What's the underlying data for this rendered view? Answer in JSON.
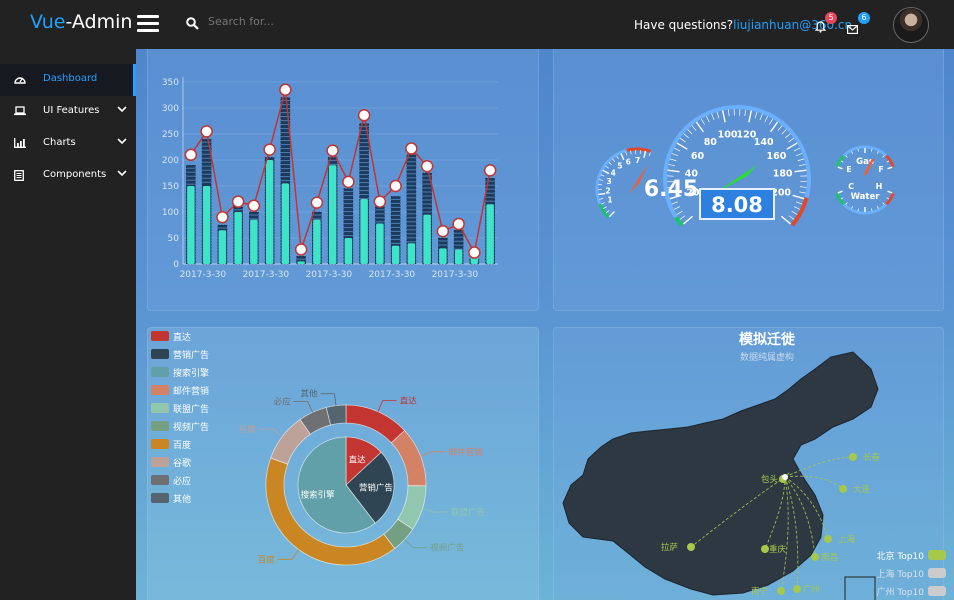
{
  "header": {
    "brand_part1": "Vue",
    "brand_part2": "-Admin",
    "search_placeholder": "Search for...",
    "question_text": "Have questions?",
    "question_email": "liujianhuan@360.cn",
    "notifications_count": "5",
    "messages_count": "6"
  },
  "sidebar": {
    "items": [
      {
        "label": "Dashboard",
        "icon": "dashboard-icon",
        "active": true
      },
      {
        "label": "UI Features",
        "icon": "laptop-icon",
        "expandable": true
      },
      {
        "label": "Charts",
        "icon": "bar-chart-icon",
        "expandable": true
      },
      {
        "label": "Components",
        "icon": "document-icon",
        "expandable": true
      }
    ]
  },
  "colors": {
    "accent": "#20a0ff",
    "topbar": "#222222",
    "sidebar": "#222222",
    "line_red": "#c23531",
    "bar_teal": "#3fe3c8",
    "bar_dark": "#1c3a5c"
  },
  "chart_data": [
    {
      "type": "bar",
      "ylim": [
        0,
        350
      ],
      "yticks": [
        "0",
        "50",
        "100",
        "150",
        "200",
        "250",
        "300",
        "350"
      ],
      "xtick_labels": [
        "2017-3-30",
        "2017-3-30",
        "2017-3-30",
        "2017-3-30",
        "2017-3-30"
      ],
      "series": [
        {
          "values": [
            150,
            150,
            65,
            100,
            85,
            200,
            155,
            5,
            85,
            190,
            50,
            125,
            78,
            35,
            40,
            95,
            30,
            28,
            15,
            115
          ]
        },
        {
          "values": [
            190,
            240,
            75,
            110,
            100,
            205,
            320,
            15,
            100,
            205,
            145,
            270,
            110,
            130,
            210,
            175,
            50,
            65,
            10,
            165
          ]
        },
        {
          "values": [
            210,
            255,
            90,
            120,
            112,
            220,
            335,
            28,
            118,
            218,
            158,
            286,
            120,
            150,
            222,
            188,
            63,
            77,
            22,
            180
          ]
        }
      ]
    },
    {
      "type": "gauge",
      "gauges": [
        {
          "name": "main",
          "value": "8.08",
          "min": 0,
          "max": 220,
          "ticks": [
            "20",
            "40",
            "60",
            "80",
            "100",
            "120",
            "140",
            "160",
            "180",
            "200"
          ]
        },
        {
          "name": "left",
          "value": "6.45",
          "ticks": [
            "1",
            "2",
            "3",
            "4",
            "5",
            "6",
            "7"
          ]
        },
        {
          "name": "gas",
          "label": "Gas",
          "ticks": [
            "E",
            "F"
          ]
        },
        {
          "name": "water",
          "label": "Water",
          "ticks": [
            "C",
            "H"
          ]
        }
      ]
    },
    {
      "type": "pie",
      "legend": [
        "直达",
        "营销广告",
        "搜索引擎",
        "邮件营销",
        "联盟广告",
        "视频广告",
        "百度",
        "谷歌",
        "必应",
        "其他"
      ],
      "legend_colors": [
        "#c23531",
        "#2f4554",
        "#61a0a8",
        "#d48265",
        "#91c7ae",
        "#749f83",
        "#ca8622",
        "#bda29a",
        "#6e7074",
        "#546570"
      ],
      "inner": [
        {
          "name": "直达",
          "value": 335
        },
        {
          "name": "营销广告",
          "value": 679
        },
        {
          "name": "搜索引擎",
          "value": 1548
        }
      ],
      "outer": [
        {
          "name": "直达",
          "value": 335
        },
        {
          "name": "邮件营销",
          "value": 310
        },
        {
          "name": "联盟广告",
          "value": 234
        },
        {
          "name": "视频广告",
          "value": 135
        },
        {
          "name": "百度",
          "value": 1048
        },
        {
          "name": "谷歌",
          "value": 251
        },
        {
          "name": "必应",
          "value": 147
        },
        {
          "name": "其他",
          "value": 102
        }
      ]
    }
  ],
  "map": {
    "title": "模拟迁徙",
    "subtitle": "数据纯属虚构",
    "cities": [
      "包头",
      "长春",
      "大连",
      "上海",
      "南昌",
      "重庆",
      "拉萨",
      "南宁",
      "广州"
    ],
    "legend": [
      {
        "label": "北京 Top10",
        "color": "#a6c84c"
      },
      {
        "label": "上海 Top10",
        "color": "#cccccc"
      },
      {
        "label": "广州 Top10",
        "color": "#cccccc"
      }
    ]
  }
}
